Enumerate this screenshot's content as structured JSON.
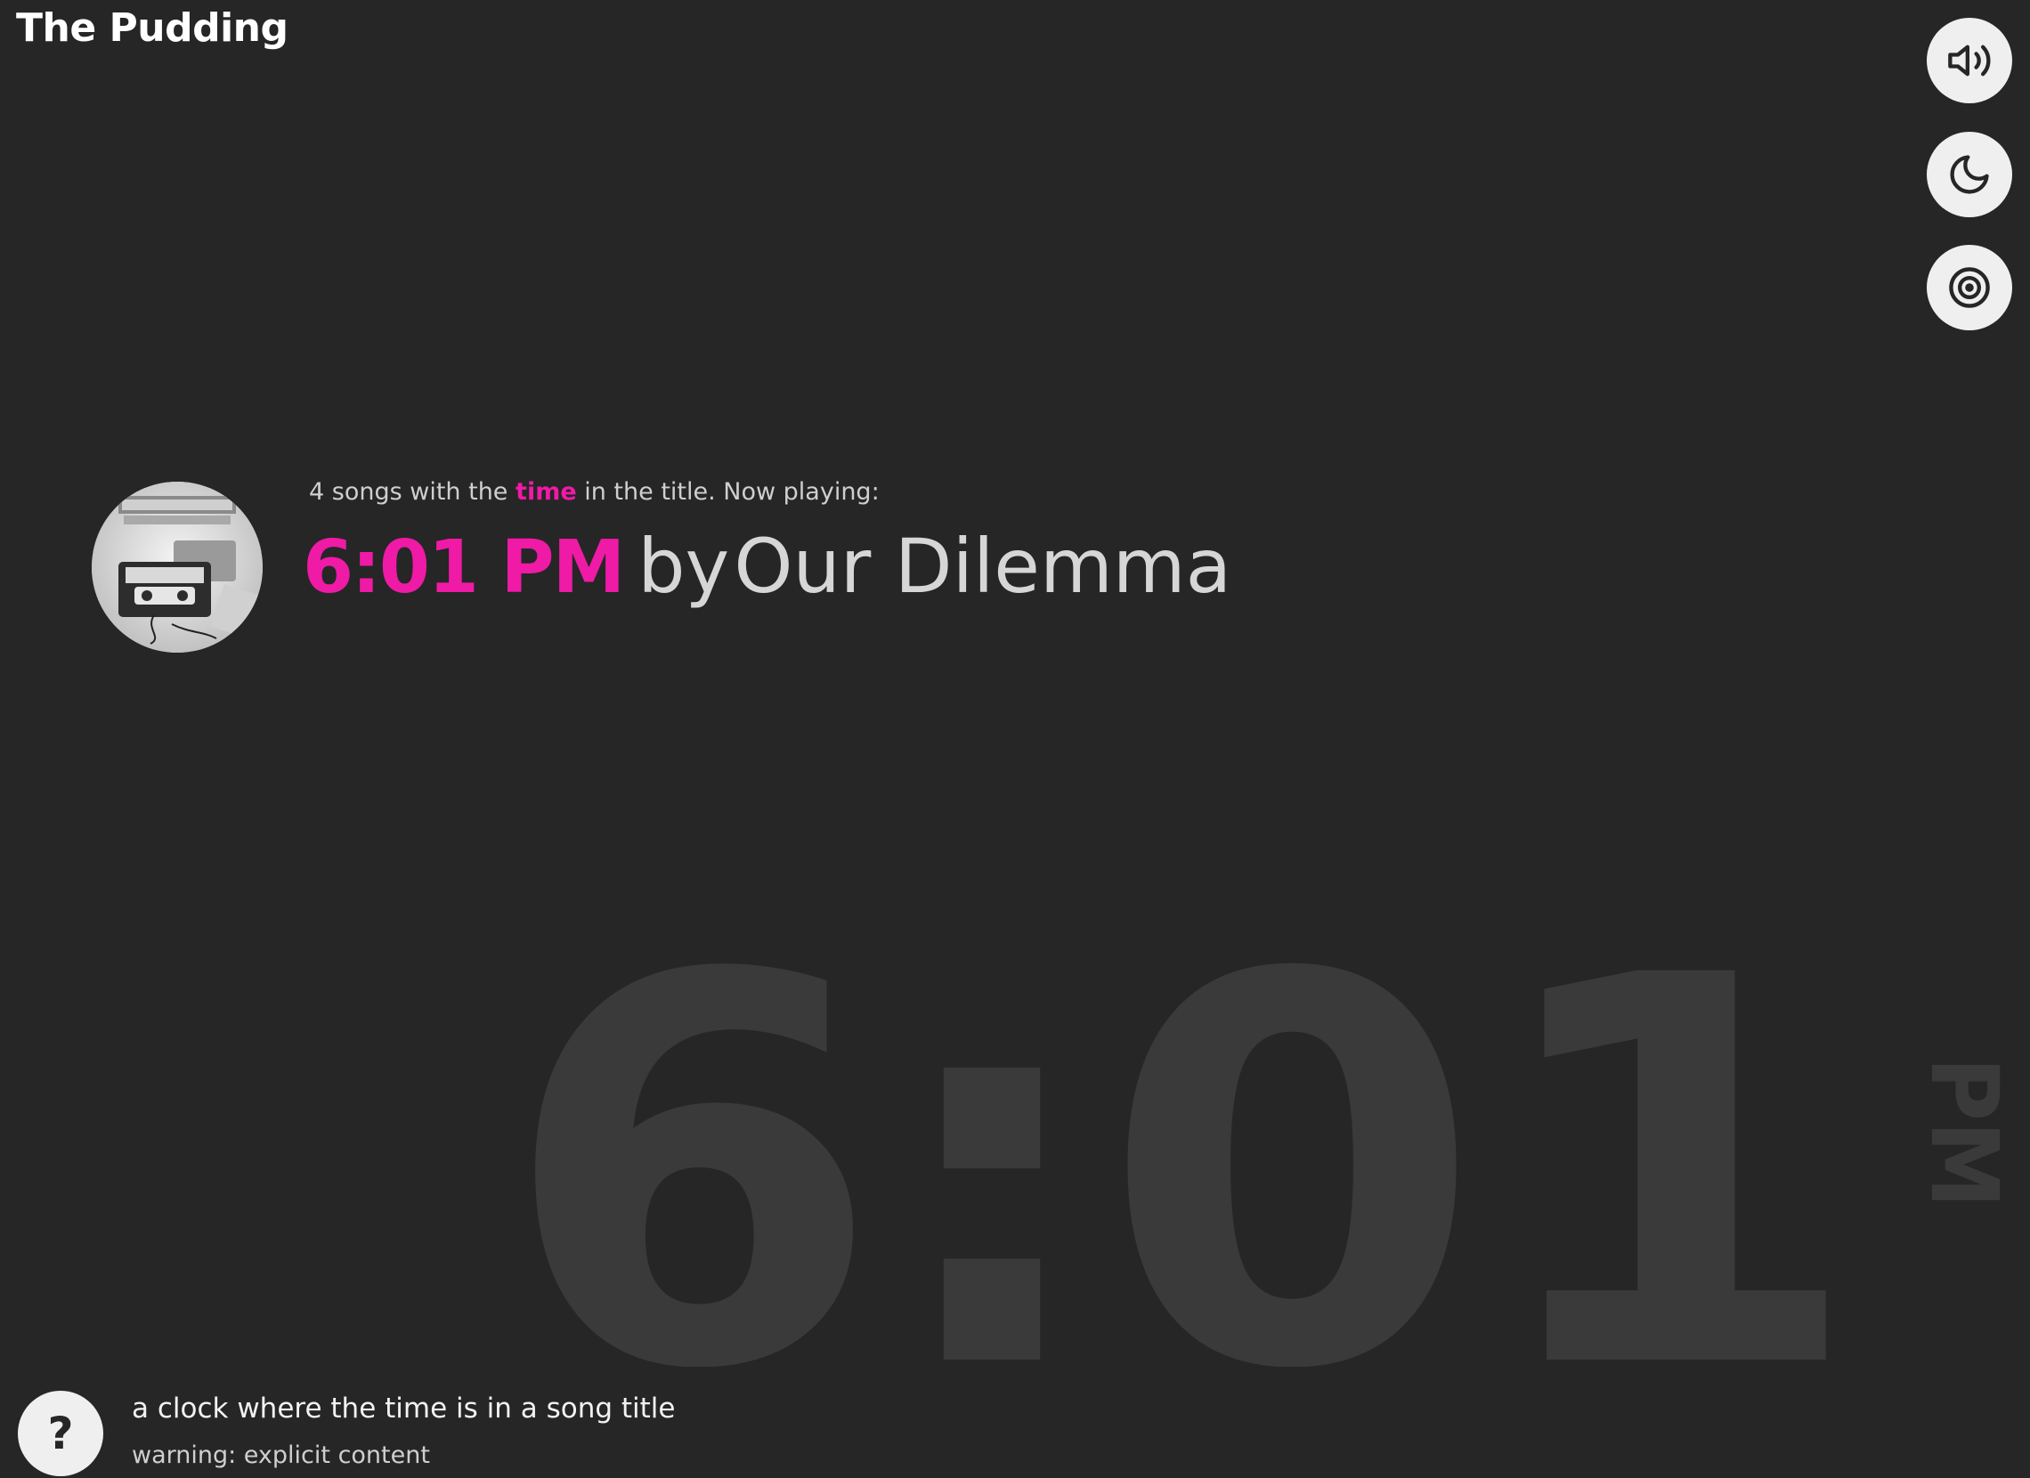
{
  "header": {
    "logo_text": "The Pudding"
  },
  "controls": [
    {
      "name": "sound",
      "icon": "speaker-icon"
    },
    {
      "name": "dark-mode",
      "icon": "moon-icon"
    },
    {
      "name": "vinyl",
      "icon": "vinyl-icon"
    }
  ],
  "intro": {
    "prefix": "4 songs with the",
    "highlight": "time",
    "suffix": "in the title. Now playing:"
  },
  "now_playing": {
    "title": "6:01 PM",
    "by": "by",
    "artist": "Our Dilemma"
  },
  "big_clock": {
    "time": "6:01",
    "period": "PM"
  },
  "footer": {
    "help_label": "?",
    "tagline": "a clock where the time is in a song title",
    "warning": "warning: explicit content"
  },
  "colors": {
    "background": "#262626",
    "accent": "#ef1aa6",
    "text": "#d6d6d6",
    "button_bg": "#efefef",
    "clock_digits": "#3a3a3a"
  }
}
